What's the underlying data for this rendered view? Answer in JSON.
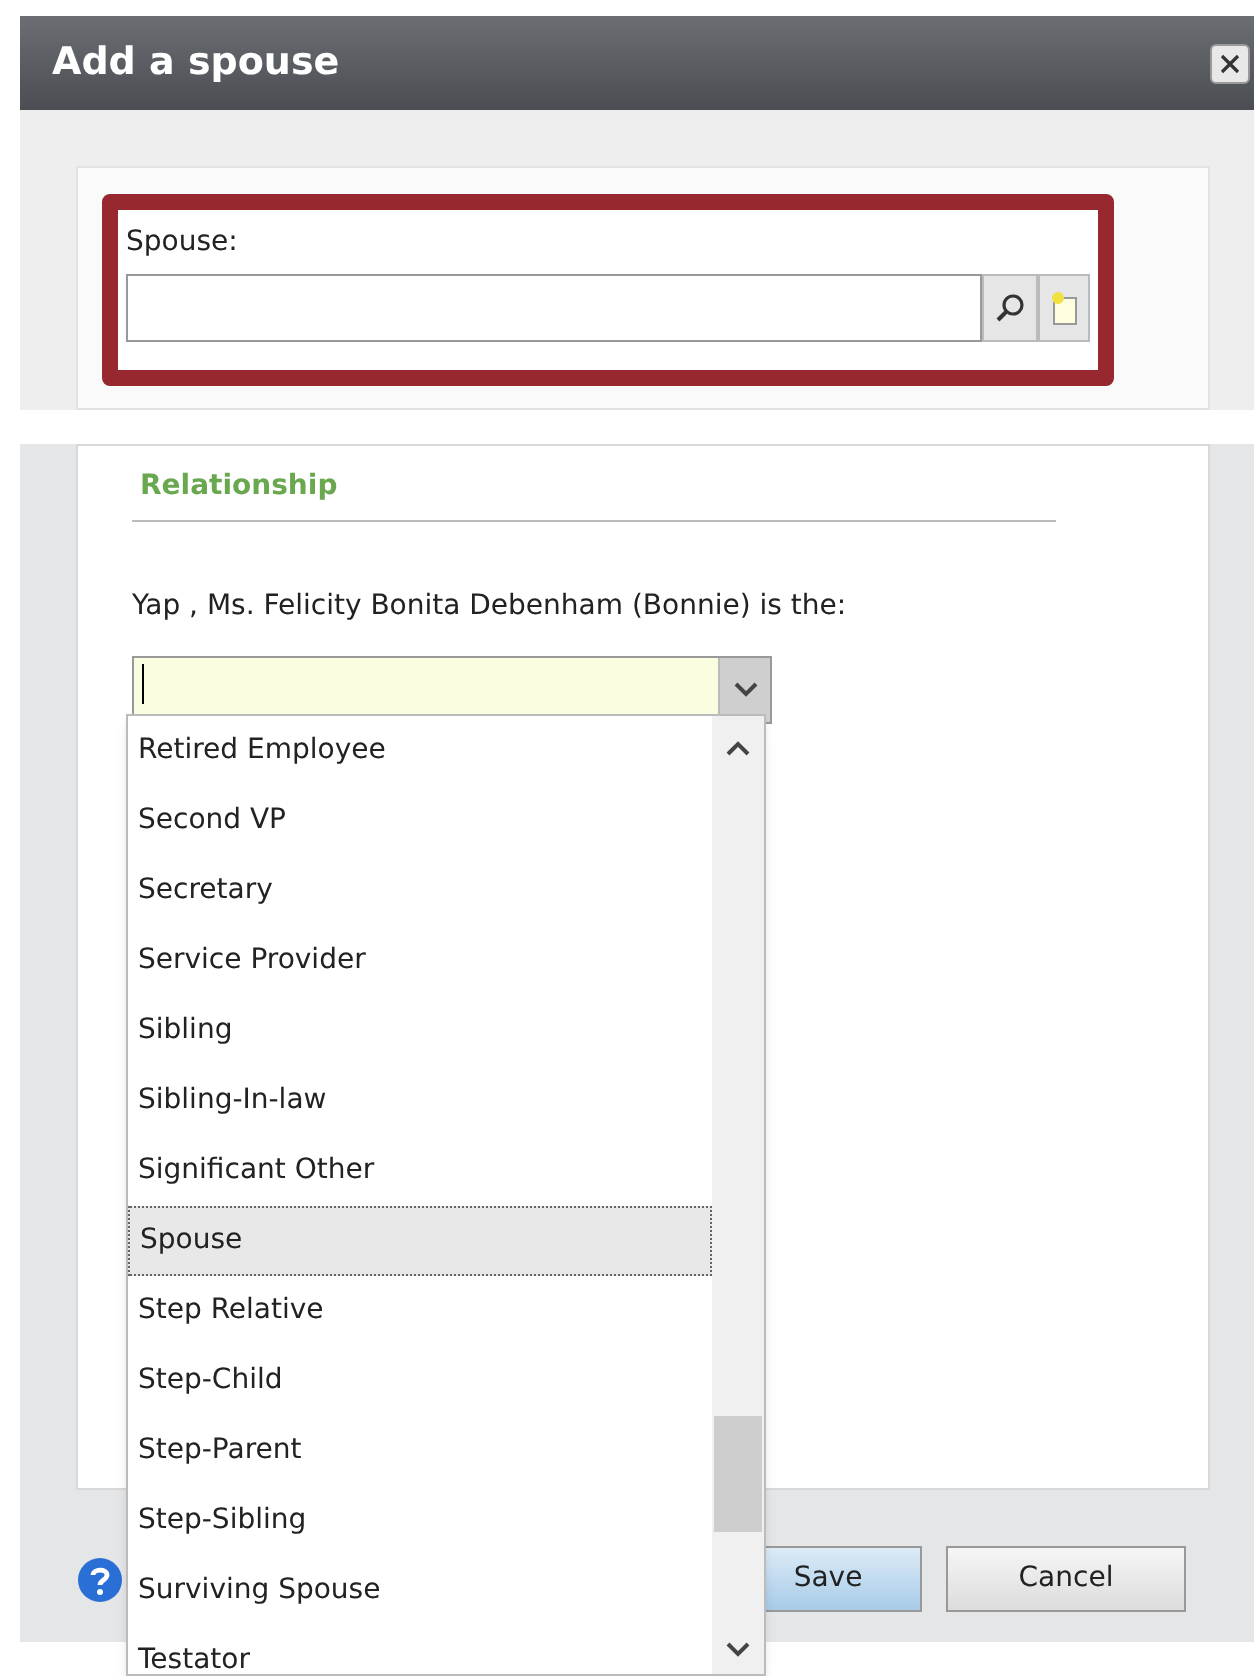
{
  "dialog": {
    "title": "Add a spouse"
  },
  "spouse_field": {
    "label": "Spouse:"
  },
  "section": {
    "title": "Relationship"
  },
  "prompt": "Yap , Ms. Felicity Bonita Debenham (Bonnie) is the:",
  "relationship_dropdown": {
    "expanded": true,
    "items": [
      {
        "label": "Retired Employee",
        "selected": false
      },
      {
        "label": "Second VP",
        "selected": false
      },
      {
        "label": "Secretary",
        "selected": false
      },
      {
        "label": "Service Provider",
        "selected": false
      },
      {
        "label": "Sibling",
        "selected": false
      },
      {
        "label": "Sibling-In-law",
        "selected": false
      },
      {
        "label": "Significant Other",
        "selected": false
      },
      {
        "label": "Spouse",
        "selected": true
      },
      {
        "label": "Step Relative",
        "selected": false
      },
      {
        "label": "Step-Child",
        "selected": false
      },
      {
        "label": "Step-Parent",
        "selected": false
      },
      {
        "label": "Step-Sibling",
        "selected": false
      },
      {
        "label": "Surviving Spouse",
        "selected": false
      },
      {
        "label": "Testator",
        "selected": false
      }
    ]
  },
  "buttons": [
    {
      "label": "Save",
      "kind": "primary"
    },
    {
      "label": "Cancel",
      "kind": "secondary"
    }
  ]
}
